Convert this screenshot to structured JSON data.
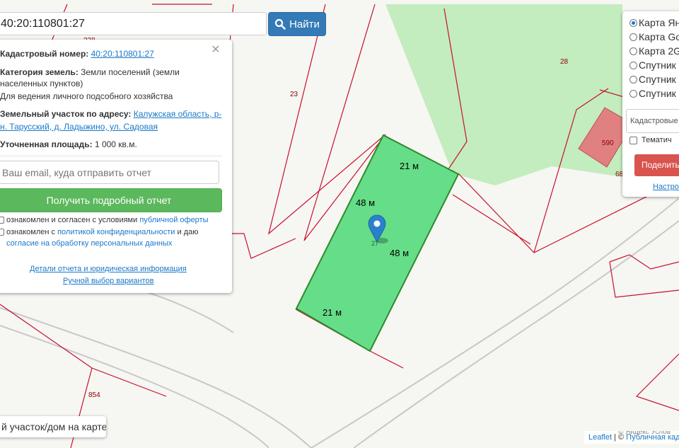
{
  "search": {
    "value": "40:20:110801:27",
    "button_label": "Найти"
  },
  "info": {
    "cadastral_label": "Кадастровый номер:",
    "cadastral_value": "40:20:110801:27",
    "category_label": "Категория земель:",
    "category_value_1": "Земли поселений (земли",
    "category_value_2": "населенных пунктов)",
    "purpose": "Для ведения личного подсобного хозяйства",
    "address_label": "Земельный участок по адресу:",
    "address_1": "Калужская область, р-",
    "address_2": "н. Тарусский, д. Ладыжино, ул. Садовая",
    "area_label": "Уточненная площадь:",
    "area_value": "1 000 кв.м.",
    "email_placeholder": "Ваш email, куда отправить отчет",
    "report_button": "Получить подробный отчет",
    "consent1_text": "ознакомлен и согласен с условиями",
    "consent1_link": "публичной оферты",
    "consent2_text": "ознакомлен с",
    "consent2_link": "политикой конфиденциальности",
    "consent2_tail": "и даю",
    "consent2_link2": "согласие на обработку персональных данных",
    "details_link": "Детали отчета и юридическая информация",
    "manual_link": "Ручной выбор вариантов"
  },
  "layers": {
    "options": [
      {
        "label": "Карта Ян",
        "selected": true
      },
      {
        "label": "Карта Go",
        "selected": false
      },
      {
        "label": "Карта 2G",
        "selected": false
      },
      {
        "label": "Спутник",
        "selected": false
      },
      {
        "label": "Спутник",
        "selected": false
      },
      {
        "label": "Спутник",
        "selected": false
      }
    ],
    "select_value": "Кадастровые",
    "thematic_label": "Тематич",
    "share_button": "Поделить",
    "settings_link": "Настро"
  },
  "map": {
    "parcel_labels": [
      "23",
      "28",
      "590",
      "68",
      "27",
      "854",
      "238"
    ],
    "edge_labels": {
      "top": "21 м",
      "left": "48 м",
      "right": "48 м",
      "bottom": "21 м"
    }
  },
  "question": "й участок/дом на карте?",
  "attribution": {
    "leaflet": "Leaflet",
    "sep": " | ©",
    "source": "Публичная кад",
    "gray": "© Яндекс  Услов"
  },
  "colors": {
    "parcel_fill": "#66dd88",
    "cadastre_line": "#c8102e",
    "forest": "#bfeabb",
    "building": "#e08080",
    "button_blue": "#337ab7",
    "button_green": "#5cb85c",
    "button_red": "#d9534f"
  }
}
